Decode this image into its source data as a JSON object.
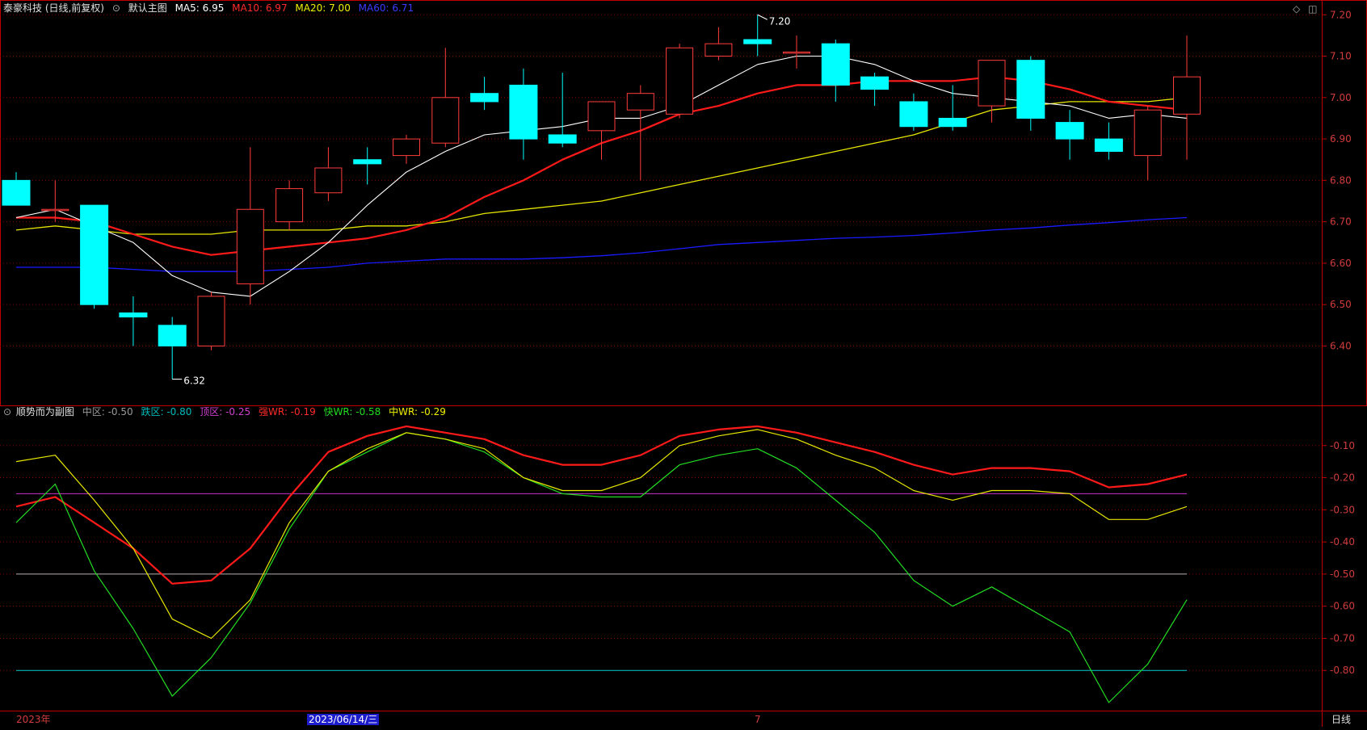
{
  "colors": {
    "background": "#000000",
    "grid": "#8b0000",
    "axis": "#c00000",
    "axis_text": "#d23c3c",
    "bull": "#ff3c3c",
    "bear": "#00ffff",
    "ma5": "#ffffff",
    "ma10": "#ff1a1a",
    "ma20": "#e6e600",
    "ma60": "#1a1aff",
    "wr_strong": "#ff1a1a",
    "wr_fast": "#22dd22",
    "wr_mid": "#e6e600",
    "line_mid": "#b0b0b0",
    "line_low": "#00cccc",
    "line_top": "#cc33cc"
  },
  "main_header": {
    "icon": "circle-chevron-icon",
    "title": "泰豪科技 (日线,前复权)",
    "chart_name": "默认主图",
    "ma5": "MA5: 6.95",
    "ma10": "MA10: 6.97",
    "ma20": "MA20: 7.00",
    "ma60": "MA60: 6.71"
  },
  "sub_header": {
    "icon": "circle-chevron-icon",
    "title": "顺势而为副图",
    "mid": "中区: -0.50",
    "low": "跌区: -0.80",
    "top": "顶区: -0.25",
    "strong": "强WR: -0.19",
    "fast": "快WR: -0.58",
    "middle": "中WR: -0.29"
  },
  "window_icons": [
    "diamond-icon",
    "window-icon"
  ],
  "bottom_axis": {
    "year": "2023年",
    "cursor_date": "2023/06/14/三",
    "month": "7",
    "period_label": "日线"
  },
  "chart_data": [
    {
      "type": "candlestick",
      "title": "泰豪科技 (日线,前复权)",
      "ylim": [
        6.28,
        7.22
      ],
      "yticks": [
        "7.20",
        "7.10",
        "7.00",
        "6.90",
        "6.80",
        "6.70",
        "6.60",
        "6.50",
        "6.40"
      ],
      "candles": [
        {
          "o": 6.8,
          "h": 6.82,
          "l": 6.74,
          "c": 6.74
        },
        {
          "o": 6.73,
          "h": 6.8,
          "l": 6.7,
          "c": 6.73
        },
        {
          "o": 6.74,
          "h": 6.74,
          "l": 6.49,
          "c": 6.5
        },
        {
          "o": 6.48,
          "h": 6.52,
          "l": 6.4,
          "c": 6.47
        },
        {
          "o": 6.45,
          "h": 6.47,
          "l": 6.32,
          "c": 6.4
        },
        {
          "o": 6.4,
          "h": 6.53,
          "l": 6.39,
          "c": 6.52
        },
        {
          "o": 6.55,
          "h": 6.88,
          "l": 6.5,
          "c": 6.73
        },
        {
          "o": 6.7,
          "h": 6.8,
          "l": 6.68,
          "c": 6.78
        },
        {
          "o": 6.77,
          "h": 6.88,
          "l": 6.75,
          "c": 6.83
        },
        {
          "o": 6.85,
          "h": 6.88,
          "l": 6.79,
          "c": 6.84
        },
        {
          "o": 6.86,
          "h": 6.91,
          "l": 6.84,
          "c": 6.9
        },
        {
          "o": 6.89,
          "h": 7.12,
          "l": 6.88,
          "c": 7.0
        },
        {
          "o": 7.01,
          "h": 7.05,
          "l": 6.97,
          "c": 6.99
        },
        {
          "o": 7.03,
          "h": 7.07,
          "l": 6.85,
          "c": 6.9
        },
        {
          "o": 6.91,
          "h": 7.06,
          "l": 6.88,
          "c": 6.89
        },
        {
          "o": 6.92,
          "h": 6.99,
          "l": 6.85,
          "c": 6.99
        },
        {
          "o": 6.97,
          "h": 7.03,
          "l": 6.8,
          "c": 7.01
        },
        {
          "o": 6.96,
          "h": 7.13,
          "l": 6.95,
          "c": 7.12
        },
        {
          "o": 7.1,
          "h": 7.17,
          "l": 7.09,
          "c": 7.13
        },
        {
          "o": 7.14,
          "h": 7.2,
          "l": 7.1,
          "c": 7.13
        },
        {
          "o": 7.11,
          "h": 7.15,
          "l": 7.07,
          "c": 7.11
        },
        {
          "o": 7.13,
          "h": 7.14,
          "l": 6.99,
          "c": 7.03
        },
        {
          "o": 7.05,
          "h": 7.06,
          "l": 6.98,
          "c": 7.02
        },
        {
          "o": 6.99,
          "h": 7.01,
          "l": 6.92,
          "c": 6.93
        },
        {
          "o": 6.95,
          "h": 7.03,
          "l": 6.92,
          "c": 6.93
        },
        {
          "o": 6.98,
          "h": 7.07,
          "l": 6.94,
          "c": 7.09
        },
        {
          "o": 7.09,
          "h": 7.1,
          "l": 6.92,
          "c": 6.95
        },
        {
          "o": 6.94,
          "h": 6.97,
          "l": 6.85,
          "c": 6.9
        },
        {
          "o": 6.9,
          "h": 6.94,
          "l": 6.85,
          "c": 6.87
        },
        {
          "o": 6.86,
          "h": 6.98,
          "l": 6.8,
          "c": 6.97
        },
        {
          "o": 6.96,
          "h": 7.15,
          "l": 6.85,
          "c": 7.05
        }
      ],
      "ma5": [
        6.71,
        6.73,
        6.69,
        6.65,
        6.57,
        6.53,
        6.52,
        6.58,
        6.65,
        6.74,
        6.82,
        6.87,
        6.91,
        6.92,
        6.93,
        6.95,
        6.95,
        6.98,
        7.03,
        7.08,
        7.1,
        7.1,
        7.08,
        7.04,
        7.01,
        7.0,
        6.99,
        6.98,
        6.95,
        6.96,
        6.95
      ],
      "ma10": [
        6.71,
        6.71,
        6.7,
        6.67,
        6.64,
        6.62,
        6.63,
        6.64,
        6.65,
        6.66,
        6.68,
        6.71,
        6.76,
        6.8,
        6.85,
        6.89,
        6.92,
        6.96,
        6.98,
        7.01,
        7.03,
        7.03,
        7.04,
        7.04,
        7.04,
        7.05,
        7.04,
        7.02,
        6.99,
        6.98,
        6.97
      ],
      "ma20": [
        6.68,
        6.69,
        6.68,
        6.67,
        6.67,
        6.67,
        6.68,
        6.68,
        6.68,
        6.69,
        6.69,
        6.7,
        6.72,
        6.73,
        6.74,
        6.75,
        6.77,
        6.79,
        6.81,
        6.83,
        6.85,
        6.87,
        6.89,
        6.91,
        6.94,
        6.97,
        6.98,
        6.99,
        6.99,
        6.99,
        7.0
      ],
      "ma60": [
        6.59,
        6.59,
        6.59,
        6.585,
        6.58,
        6.58,
        6.58,
        6.585,
        6.59,
        6.6,
        6.605,
        6.61,
        6.61,
        6.61,
        6.613,
        6.618,
        6.625,
        6.635,
        6.645,
        6.65,
        6.655,
        6.66,
        6.663,
        6.667,
        6.673,
        6.68,
        6.685,
        6.692,
        6.698,
        6.705,
        6.71
      ],
      "annotations": [
        {
          "text": "7.20",
          "candle": 19,
          "at": "high"
        },
        {
          "text": "6.32",
          "candle": 4,
          "at": "low"
        }
      ]
    },
    {
      "type": "line",
      "title": "顺势而为副图",
      "ylim": [
        -0.915,
        0.015
      ],
      "yticks": [
        "-0.10",
        "-0.20",
        "-0.30",
        "-0.40",
        "-0.50",
        "-0.60",
        "-0.70",
        "-0.80"
      ],
      "hlines": [
        {
          "name": "中区",
          "value": -0.5
        },
        {
          "name": "跌区",
          "value": -0.8
        },
        {
          "name": "顶区",
          "value": -0.25
        }
      ],
      "series": [
        {
          "name": "强WR",
          "values": [
            -0.29,
            -0.26,
            -0.34,
            -0.42,
            -0.53,
            -0.52,
            -0.42,
            -0.26,
            -0.12,
            -0.07,
            -0.04,
            -0.06,
            -0.08,
            -0.13,
            -0.16,
            -0.16,
            -0.13,
            -0.07,
            -0.05,
            -0.04,
            -0.06,
            -0.09,
            -0.12,
            -0.16,
            -0.19,
            -0.17,
            -0.17,
            -0.18,
            -0.23,
            -0.22,
            -0.19
          ]
        },
        {
          "name": "快WR",
          "values": [
            -0.34,
            -0.22,
            -0.49,
            -0.67,
            -0.88,
            -0.76,
            -0.59,
            -0.36,
            -0.18,
            -0.12,
            -0.06,
            -0.08,
            -0.12,
            -0.2,
            -0.25,
            -0.26,
            -0.26,
            -0.16,
            -0.13,
            -0.11,
            -0.17,
            -0.27,
            -0.37,
            -0.52,
            -0.6,
            -0.54,
            -0.61,
            -0.68,
            -0.9,
            -0.78,
            -0.58
          ]
        },
        {
          "name": "中WR",
          "values": [
            -0.15,
            -0.13,
            -0.27,
            -0.42,
            -0.64,
            -0.7,
            -0.58,
            -0.34,
            -0.18,
            -0.11,
            -0.06,
            -0.08,
            -0.11,
            -0.2,
            -0.24,
            -0.24,
            -0.2,
            -0.1,
            -0.07,
            -0.05,
            -0.08,
            -0.13,
            -0.17,
            -0.24,
            -0.27,
            -0.24,
            -0.24,
            -0.25,
            -0.33,
            -0.33,
            -0.29
          ]
        }
      ]
    }
  ]
}
